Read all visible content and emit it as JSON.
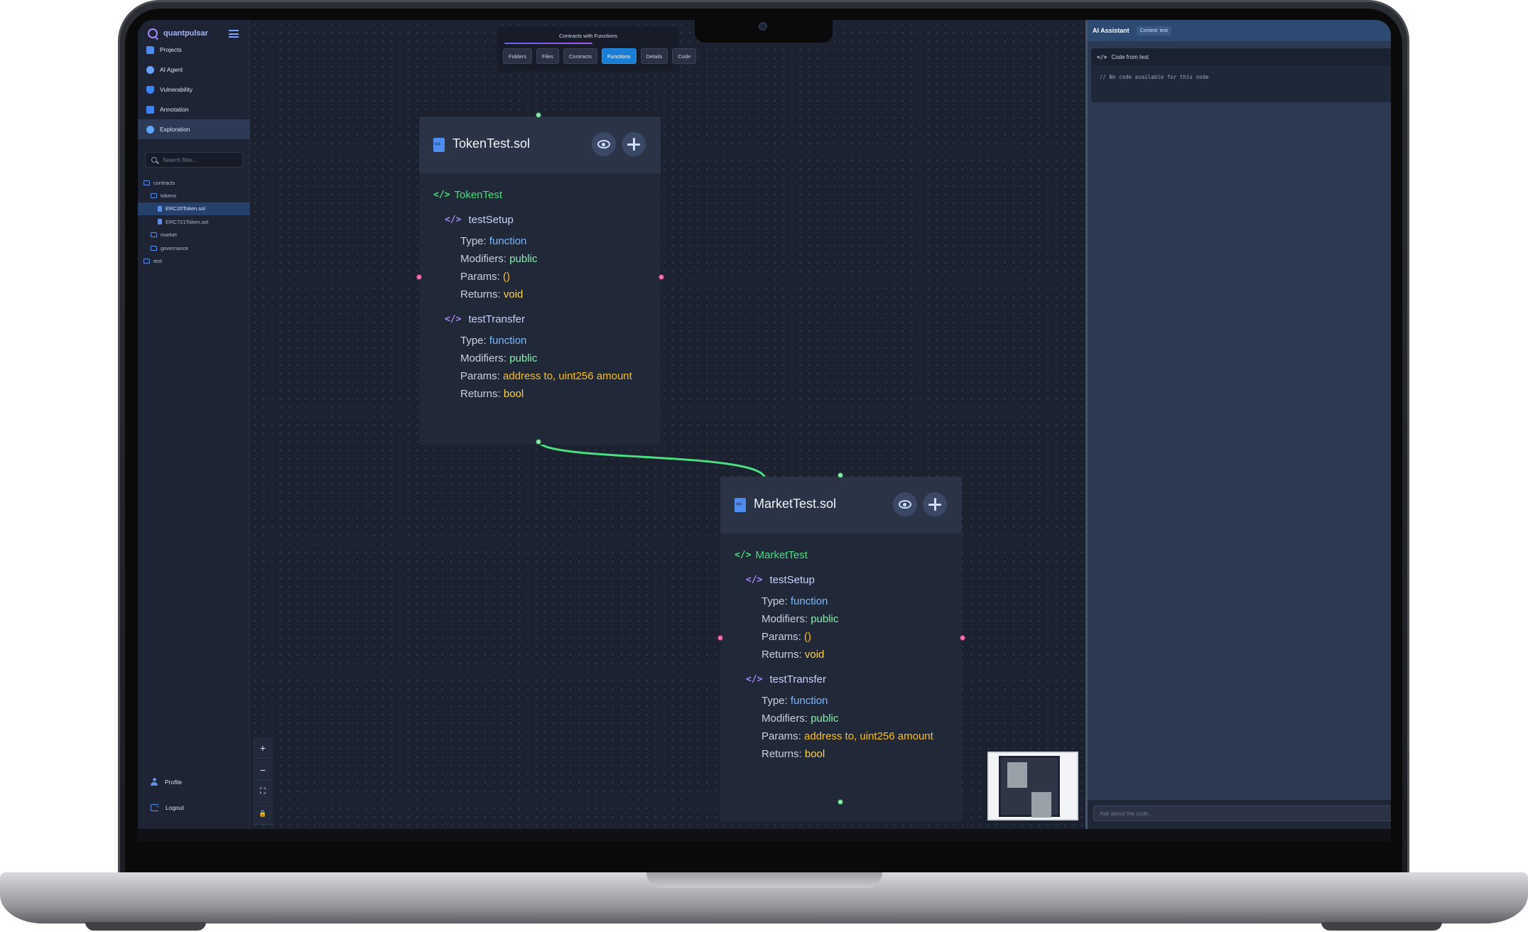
{
  "app": {
    "brand": "quantpulsar"
  },
  "sidebar": {
    "items": [
      {
        "label": "Projects",
        "icon": "folder-icon"
      },
      {
        "label": "AI Agent",
        "icon": "agent-icon"
      },
      {
        "label": "Vulnerability",
        "icon": "shield-icon"
      },
      {
        "label": "Annotation",
        "icon": "annotation-icon"
      },
      {
        "label": "Exploration",
        "icon": "compass-icon",
        "active": true
      }
    ],
    "search_placeholder": "Search files...",
    "tree": [
      {
        "label": "contracts",
        "kind": "folder",
        "depth": 0
      },
      {
        "label": "tokens",
        "kind": "folder",
        "depth": 1
      },
      {
        "label": "ERC20Token.sol",
        "kind": "file",
        "depth": 2,
        "selected": true
      },
      {
        "label": "ERC721Token.sol",
        "kind": "file",
        "depth": 2
      },
      {
        "label": "market",
        "kind": "folder",
        "depth": 1
      },
      {
        "label": "governance",
        "kind": "folder",
        "depth": 1
      },
      {
        "label": "test",
        "kind": "folder",
        "depth": 0
      }
    ],
    "profile_label": "Profile",
    "logout_label": "Logout"
  },
  "toolbar": {
    "title": "Contracts with Functions",
    "tabs": [
      {
        "label": "Folders"
      },
      {
        "label": "Files"
      },
      {
        "label": "Contracts"
      },
      {
        "label": "Functions",
        "active": true
      },
      {
        "label": "Details"
      },
      {
        "label": "Code"
      }
    ]
  },
  "nodes": [
    {
      "file": "TokenTest.sol",
      "contract": "TokenTest",
      "functions": [
        {
          "name": "testSetup",
          "type": "function",
          "modifiers": "public",
          "params": "()",
          "returns": "void"
        },
        {
          "name": "testTransfer",
          "type": "function",
          "modifiers": "public",
          "params": "address to, uint256 amount",
          "returns": "bool"
        }
      ]
    },
    {
      "file": "MarketTest.sol",
      "contract": "MarketTest",
      "functions": [
        {
          "name": "testSetup",
          "type": "function",
          "modifiers": "public",
          "params": "()",
          "returns": "void"
        },
        {
          "name": "testTransfer",
          "type": "function",
          "modifiers": "public",
          "params": "address to, uint256 amount",
          "returns": "bool"
        }
      ]
    }
  ],
  "labels": {
    "type": "Type: ",
    "modifiers": "Modifiers: ",
    "params": "Params: ",
    "returns": "Returns: "
  },
  "zoom_controls": [
    "+",
    "−",
    "⛶",
    "🔒"
  ],
  "ai_panel": {
    "title": "AI Assistant",
    "context_badge": "Context: test",
    "code_card_title": "Code from test",
    "code_body": "// No code available for this node",
    "input_placeholder": "Ask about the code..."
  },
  "colors": {
    "edge": "#4ade80",
    "handle_source": "#86efac",
    "handle_side": "#f472b6",
    "active_tab": "#1a7fd4",
    "accent": "#a78bfa"
  }
}
